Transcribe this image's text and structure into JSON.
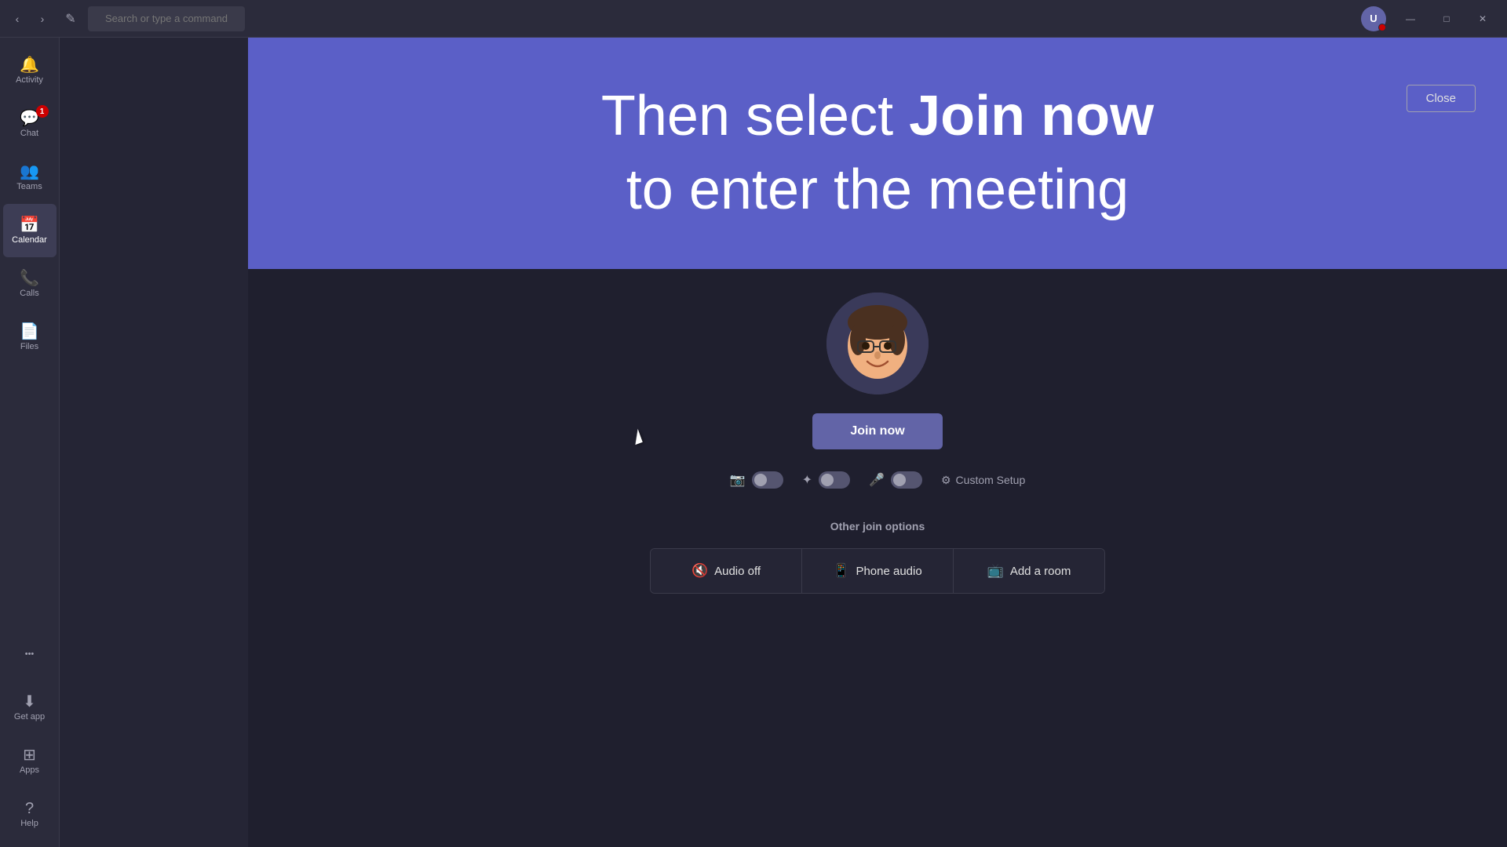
{
  "titleBar": {
    "searchPlaceholder": "Search or type a command",
    "backBtn": "‹",
    "forwardBtn": "›",
    "composeIcon": "✎",
    "minimizeLabel": "—",
    "maximizeLabel": "☐",
    "closeLabel": "✕"
  },
  "sidebar": {
    "items": [
      {
        "id": "activity",
        "label": "Activity",
        "icon": "🔔",
        "badge": null,
        "active": false
      },
      {
        "id": "chat",
        "label": "Chat",
        "icon": "💬",
        "badge": "1",
        "active": false
      },
      {
        "id": "teams",
        "label": "Teams",
        "icon": "👥",
        "badge": null,
        "active": false
      },
      {
        "id": "calendar",
        "label": "Calendar",
        "icon": "📅",
        "badge": null,
        "active": true
      },
      {
        "id": "calls",
        "label": "Calls",
        "icon": "📞",
        "badge": null,
        "active": false
      },
      {
        "id": "files",
        "label": "Files",
        "icon": "📄",
        "badge": null,
        "active": false
      }
    ],
    "bottomItems": [
      {
        "id": "more",
        "label": "···",
        "icon": "···",
        "active": false
      },
      {
        "id": "getapp",
        "label": "Get app",
        "icon": "⬇",
        "active": false
      },
      {
        "id": "apps",
        "label": "Apps",
        "icon": "⊞",
        "active": false
      },
      {
        "id": "help",
        "label": "Help",
        "icon": "?",
        "active": false
      }
    ]
  },
  "instructionBanner": {
    "text1": "Then select ",
    "boldText": "Join now",
    "text2": " to enter the meeting"
  },
  "closeButton": {
    "label": "Close"
  },
  "meetingPreview": {
    "joinNowLabel": "Join now",
    "toggles": [
      {
        "id": "video",
        "icon": "📷",
        "enabled": false
      },
      {
        "id": "blur",
        "icon": "✦",
        "enabled": false
      },
      {
        "id": "mic",
        "icon": "🎤",
        "enabled": false
      }
    ],
    "customSetupLabel": "Custom Setup",
    "gearIcon": "⚙"
  },
  "otherJoinOptions": {
    "title": "Other join options",
    "buttons": [
      {
        "id": "audio-off",
        "icon": "🔇",
        "label": "Audio off"
      },
      {
        "id": "phone-audio",
        "icon": "📱",
        "label": "Phone audio"
      },
      {
        "id": "add-room",
        "icon": "📺",
        "label": "Add a room"
      }
    ]
  }
}
